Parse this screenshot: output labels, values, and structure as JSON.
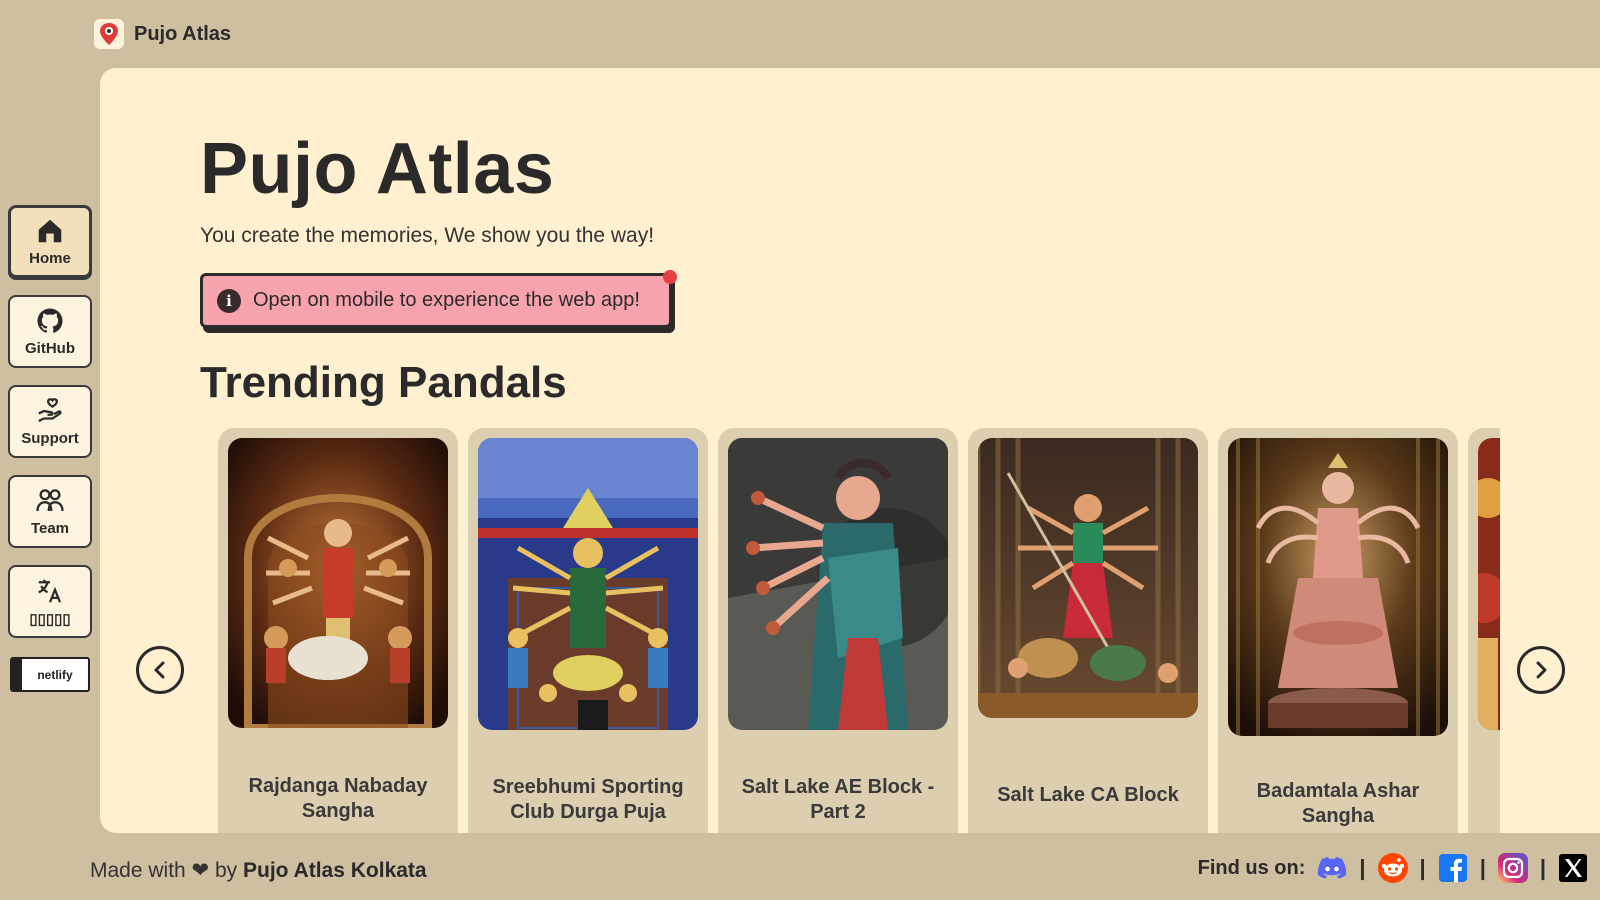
{
  "app": {
    "brand": "Pujo Atlas"
  },
  "sidebar": {
    "items": [
      {
        "label": "Home",
        "icon": "home-icon",
        "active": true
      },
      {
        "label": "GitHub",
        "icon": "github-icon"
      },
      {
        "label": "Support",
        "icon": "support-icon"
      },
      {
        "label": "Team",
        "icon": "team-icon"
      },
      {
        "label": "▯▯▯▯▯",
        "icon": "translate-icon"
      }
    ],
    "netlify_badge": "netlify"
  },
  "main": {
    "title": "Pujo Atlas",
    "tagline": "You create the memories, We show you the way!",
    "alert": "Open on mobile to experience the web app!",
    "section_title": "Trending Pandals",
    "pandals": [
      {
        "name": "Rajdanga Nabaday Sangha"
      },
      {
        "name": "Sreebhumi Sporting Club Durga Puja"
      },
      {
        "name": "Salt Lake AE Block - Part 2"
      },
      {
        "name": "Salt Lake CA Block"
      },
      {
        "name": "Badamtala Ashar Sangha"
      }
    ]
  },
  "footer": {
    "made_with": "Made with ❤ by",
    "org": "Pujo Atlas Kolkata",
    "find_us": "Find us on:",
    "socials": [
      "discord-icon",
      "reddit-icon",
      "facebook-icon",
      "instagram-icon",
      "x-icon"
    ]
  },
  "colors": {
    "background": "#cdbf9f",
    "card": "#fff0d0",
    "alert": "#f7a3ad"
  }
}
